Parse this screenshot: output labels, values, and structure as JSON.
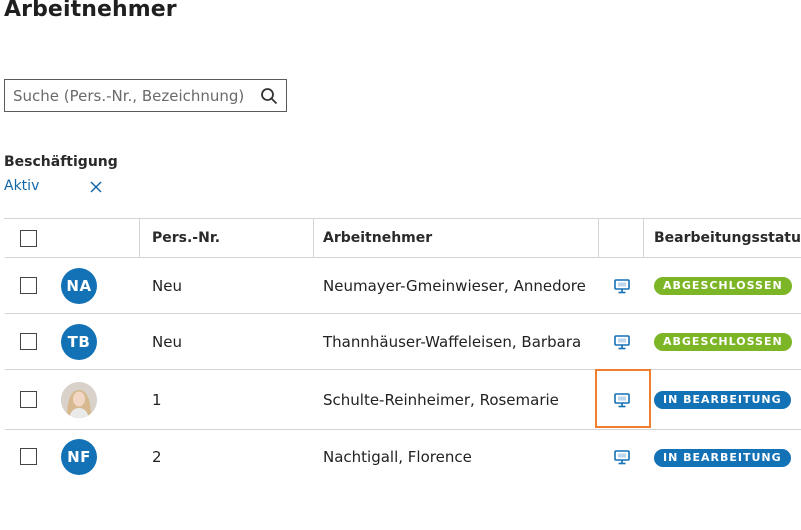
{
  "page": {
    "title": "Arbeitnehmer"
  },
  "search": {
    "placeholder": "Suche (Pers.-Nr., Bezeichnung)",
    "icon": "search-icon"
  },
  "filter": {
    "label": "Beschäftigung",
    "value": "Aktiv",
    "clear_icon": "close-icon"
  },
  "table": {
    "headers": {
      "persnr": "Pers.-Nr.",
      "name": "Arbeitnehmer",
      "status": "Bearbeitungsstatus"
    },
    "rows": [
      {
        "initials": "NA",
        "persnr": "Neu",
        "name": "Neumayer-Gmeinwieser, Annedore",
        "status": "ABGESCHLOSSEN",
        "status_color": "#7cb526"
      },
      {
        "initials": "TB",
        "persnr": "Neu",
        "name": "Thannhäuser-Waffeleisen, Barbara",
        "status": "ABGESCHLOSSEN",
        "status_color": "#7cb526"
      },
      {
        "initials": "",
        "persnr": "1",
        "name": "Schulte-Reinheimer, Rosemarie",
        "status": "IN BEARBEITUNG",
        "status_color": "#1371b5"
      },
      {
        "initials": "NF",
        "persnr": "2",
        "name": "Nachtigall, Florence",
        "status": "IN BEARBEITUNG",
        "status_color": "#1371b5"
      }
    ]
  },
  "colors": {
    "accent": "#1371b5",
    "done": "#7cb526",
    "highlight": "#ef7e2f"
  }
}
